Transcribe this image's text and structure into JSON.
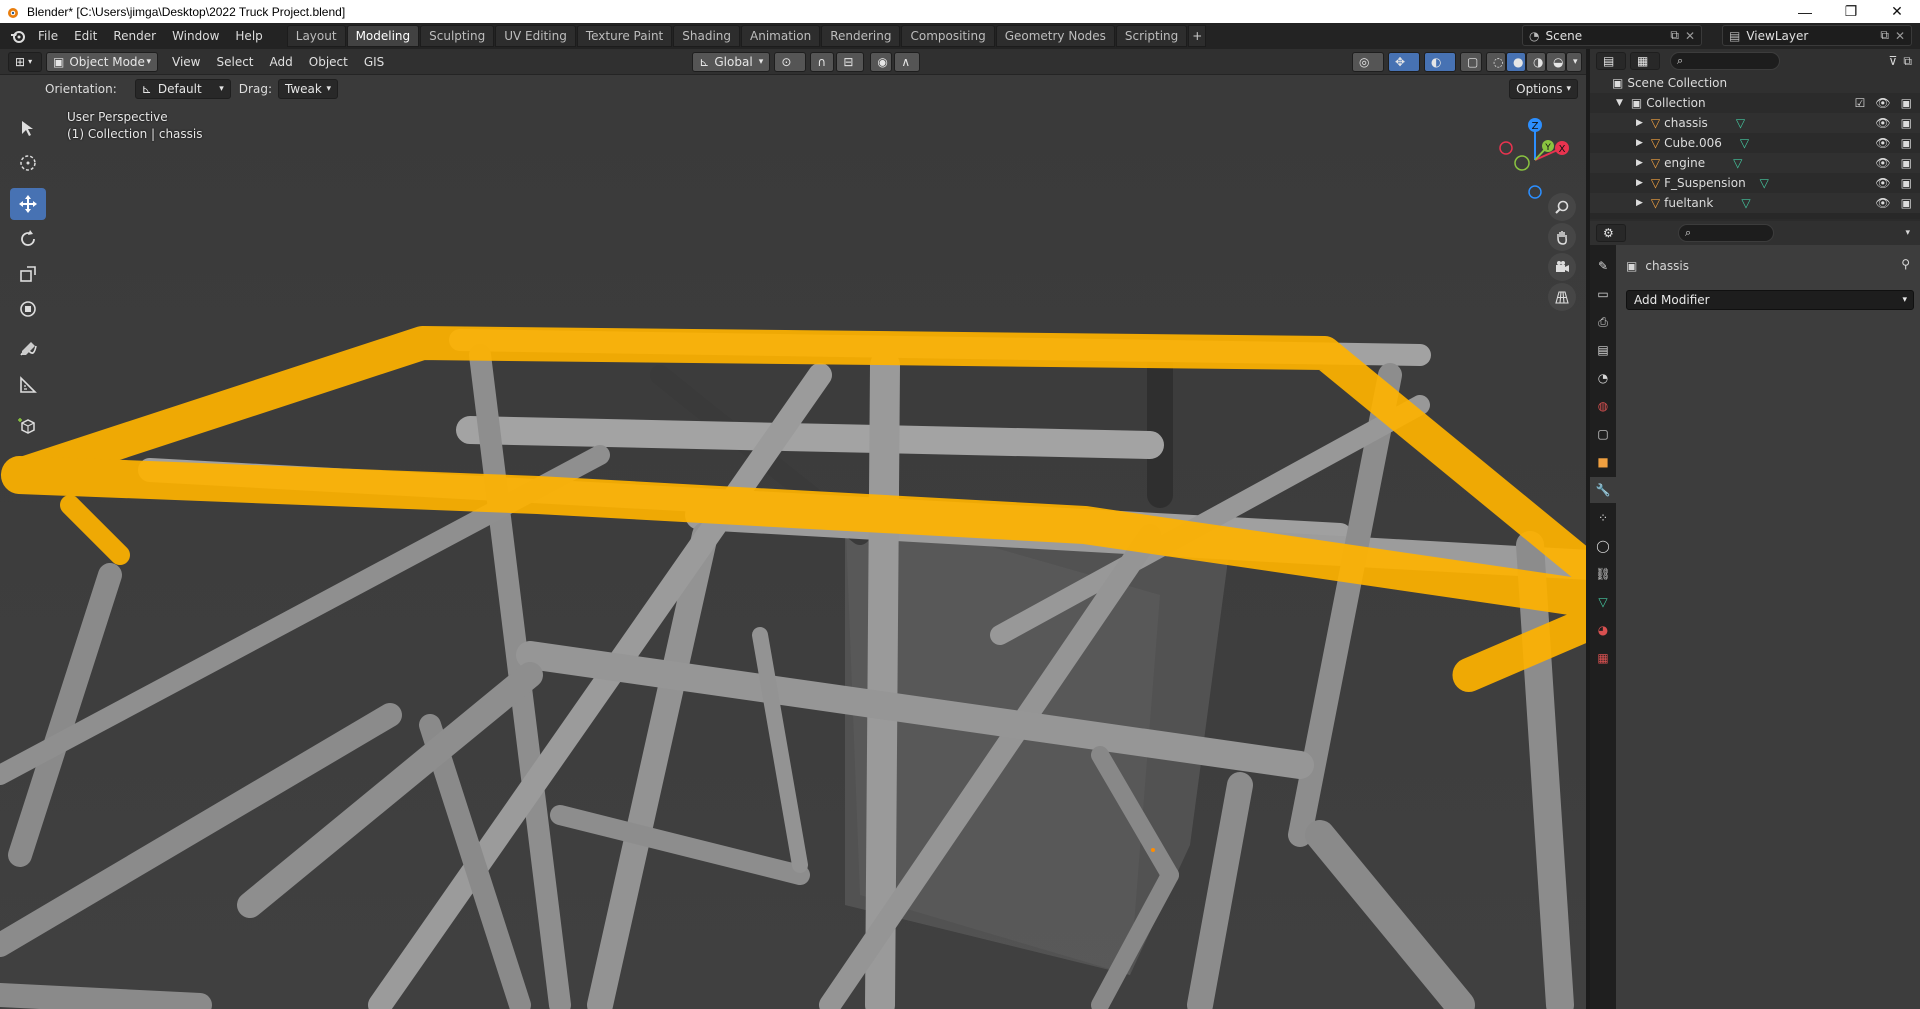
{
  "window": {
    "title": "Blender* [C:\\Users\\jimga\\Desktop\\2022 Truck Project.blend]",
    "minimize": "—",
    "maximize": "❐",
    "close": "✕"
  },
  "menu": {
    "items": [
      "File",
      "Edit",
      "Render",
      "Window",
      "Help"
    ]
  },
  "workspaces": {
    "tabs": [
      "Layout",
      "Modeling",
      "Sculpting",
      "UV Editing",
      "Texture Paint",
      "Shading",
      "Animation",
      "Rendering",
      "Compositing",
      "Geometry Nodes",
      "Scripting"
    ],
    "active": "Modeling",
    "add": "+"
  },
  "scene": {
    "name": "Scene"
  },
  "view_layer": {
    "name": "ViewLayer"
  },
  "viewport_header": {
    "mode": "Object Mode",
    "menus": [
      "View",
      "Select",
      "Add",
      "Object",
      "GIS"
    ],
    "transform_orientation": "Global"
  },
  "tool_settings": {
    "orientation_label": "Orientation:",
    "orientation_value": "Default",
    "drag_label": "Drag:",
    "drag_value": "Tweak",
    "options": "Options"
  },
  "viewport": {
    "view_name": "User Perspective",
    "context": "(1) Collection | chassis",
    "gizmo_axes": [
      "Z",
      "Y",
      "X"
    ],
    "colors": {
      "background": "#3d3d3d",
      "tube": "#9a9a9a",
      "highlight": "#ffb300",
      "x_axis": "#e8334f",
      "y_axis": "#8ac440",
      "z_axis": "#2c8fff",
      "active_tool": "#4772b3"
    }
  },
  "toolbar": {
    "tools": [
      "select-box-icon",
      "cursor-icon",
      "move-icon",
      "rotate-icon",
      "scale-icon",
      "transform-icon",
      "annotate-icon",
      "measure-icon",
      "add-cube-icon"
    ],
    "active": "move-icon"
  },
  "outliner": {
    "root": "Scene Collection",
    "collection": "Collection",
    "objects": [
      "chassis",
      "Cube.006",
      "engine",
      "F_Suspension",
      "fueltank"
    ]
  },
  "properties": {
    "object_name": "chassis",
    "add_modifier": "Add Modifier"
  }
}
